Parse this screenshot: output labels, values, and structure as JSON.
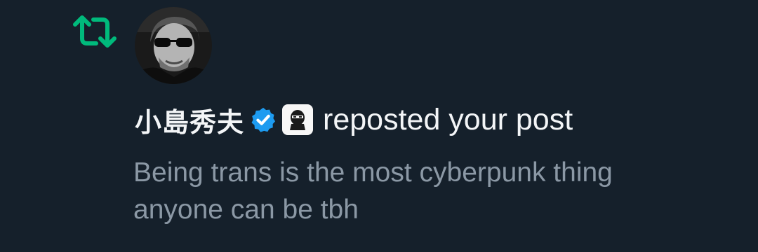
{
  "colors": {
    "background": "#15202b",
    "repost_green": "#00ba7c",
    "verified_blue": "#1d9bf0",
    "primary_text": "#f3f5f7",
    "secondary_text": "#8b98a5"
  },
  "notification": {
    "type_icon": "repost-icon",
    "avatar_icon": "user-avatar",
    "display_name": "小島秀夫",
    "verified_icon": "verified-badge-icon",
    "affiliate_icon": "affiliate-logo-icon",
    "action_text": "reposted your post",
    "post_lines": [
      "Being trans is the most cyberpunk thing",
      "anyone can be tbh"
    ]
  }
}
